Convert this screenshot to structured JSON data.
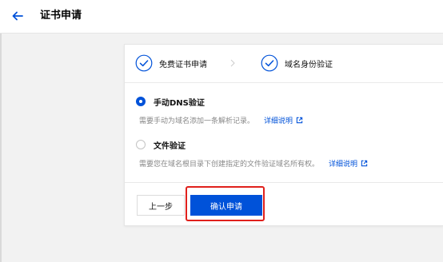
{
  "header": {
    "title": "证书申请",
    "back_icon": "arrow-left-icon"
  },
  "steps": [
    {
      "label": "免费证书申请",
      "status": "completed"
    },
    {
      "label": "域名身份验证",
      "status": "completed"
    }
  ],
  "verification_options": [
    {
      "title": "手动DNS验证",
      "selected": true,
      "description": "需要手动为域名添加一条解析记录。",
      "link_text": "详细说明"
    },
    {
      "title": "文件验证",
      "selected": false,
      "description": "需要您在域名根目录下创建指定的文件验证域名所有权。",
      "link_text": "详细说明"
    }
  ],
  "actions": {
    "prev_label": "上一步",
    "confirm_label": "确认申请"
  },
  "colors": {
    "primary": "#0052d9",
    "highlight": "#e0201c",
    "background": "#f2f2f2",
    "muted_text": "#888888"
  }
}
